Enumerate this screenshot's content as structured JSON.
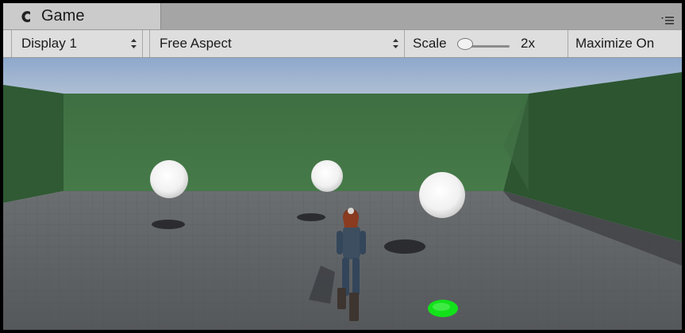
{
  "tab": {
    "title": "Game",
    "icon": "unity-game-icon"
  },
  "panel_menu_icon": "panel-menu-icon",
  "toolbar": {
    "display_value": "Display 1",
    "aspect_value": "Free Aspect",
    "scale_label": "Scale",
    "scale_value": "2x",
    "scale_slider_fraction": 0.0,
    "maximize_label": "Maximize On"
  },
  "scene": {
    "spheres": 3,
    "character": "third-person character",
    "target_marker_color": "#12e21a",
    "wall_color": "#3d6e40",
    "floor_color": "#5b5e61",
    "sky_color": "#9cb2cf"
  }
}
